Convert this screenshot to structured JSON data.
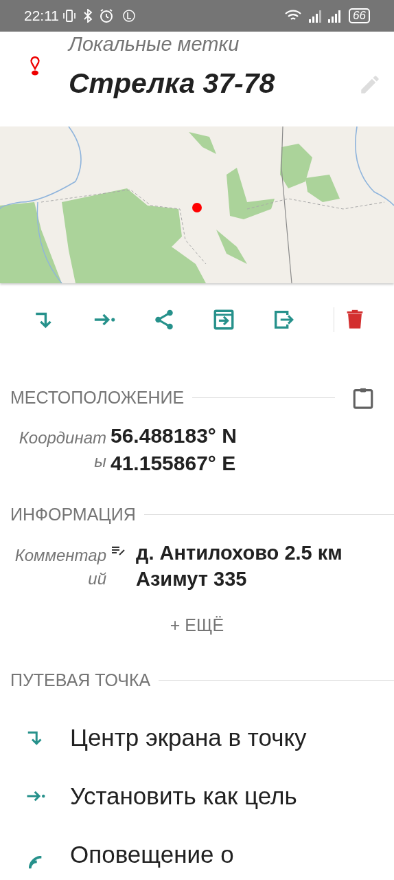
{
  "status_bar": {
    "time": "22:11",
    "battery": "66"
  },
  "header": {
    "subtitle": "Локальные метки",
    "title": "Стрелка 37-78"
  },
  "toolbar": [
    {
      "kind": "center"
    },
    {
      "kind": "target"
    },
    {
      "kind": "share"
    },
    {
      "kind": "import"
    },
    {
      "kind": "export"
    },
    {
      "kind": "divider"
    },
    {
      "kind": "delete"
    }
  ],
  "location": {
    "heading": "МЕСТОПОЛОЖЕНИЕ",
    "label_lines": [
      "Координат",
      "ы"
    ],
    "value_lines": [
      "56.488183° N",
      "41.155867° E"
    ]
  },
  "info": {
    "heading": "ИНФОРМАЦИЯ",
    "label_lines": [
      "Комментар",
      "ий"
    ],
    "value_lines": [
      "д. Антилохово 2.5 км",
      "Азимут 335"
    ],
    "more": "+ ЕЩЁ"
  },
  "waypoint": {
    "heading": "ПУТЕВАЯ ТОЧКА",
    "items": [
      {
        "kind": "center",
        "label": "Центр экрана в точку"
      },
      {
        "kind": "target",
        "label": "Установить как цель"
      },
      {
        "kind": "alert",
        "label": "Оповещение о"
      }
    ]
  }
}
